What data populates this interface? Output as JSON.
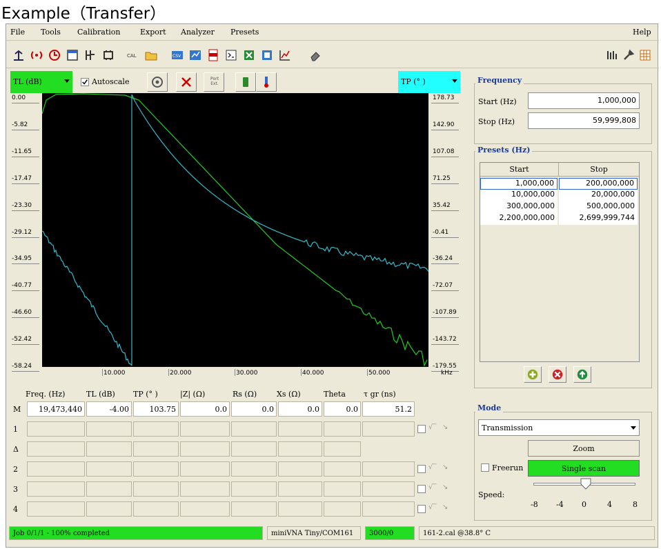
{
  "heading": "Example（Transfer）",
  "menu": {
    "file": "File",
    "tools": "Tools",
    "calibration": "Calibration",
    "export": "Export",
    "analyzer": "Analyzer",
    "presets": "Presets",
    "help": "Help"
  },
  "toolbar": {
    "icons": [
      "antenna-icon",
      "signal-icon",
      "clock-icon",
      "window-icon",
      "network-icon",
      "chip-icon",
      "cal-icon",
      "folder-icon",
      "csv-icon",
      "zplots-icon",
      "pdf-icon",
      "xml-icon",
      "excel-icon",
      "snp-icon",
      "chart-icon",
      "eraser-icon"
    ],
    "right_icons": [
      "generator-icon",
      "settings-icon",
      "calculator-icon"
    ]
  },
  "controls": {
    "left_scale": "TL (dB)",
    "autoscale_label": "Autoscale",
    "autoscale_checked": true,
    "port_ext_label": "Port Ext.",
    "right_scale": "TP (° )",
    "left_scale_color": "#22dd22",
    "right_scale_color": "#22ffff"
  },
  "plot": {
    "y_left_ticks": [
      "0.00",
      "-5.82",
      "-11.65",
      "-17.47",
      "-23.30",
      "-29.12",
      "-34.95",
      "-40.77",
      "-46.60",
      "-52.42",
      "-58.24"
    ],
    "y_right_ticks": [
      "178.73",
      "142.90",
      "107.08",
      "71.25",
      "35.42",
      "-0.41",
      "-36.24",
      "-72.07",
      "-107.89",
      "-143.72",
      "-179.55"
    ],
    "x_ticks": [
      "10.000",
      "20.000",
      "30.000",
      "40.000",
      "50.000"
    ],
    "x_unit": "kHz"
  },
  "table": {
    "headers": [
      "Freq. (Hz)",
      "TL (dB)",
      "TP (° )",
      "|Z| (Ω)",
      "Rs (Ω)",
      "Xs (Ω)",
      "Theta",
      "τ gr (ns)"
    ],
    "rows": [
      {
        "label": "M",
        "values": [
          "19,473,440",
          "-4.00",
          "103.75",
          "0.0",
          "0.0",
          "0.0",
          "0.0",
          "51.2"
        ]
      },
      {
        "label": "1",
        "values": [
          "",
          "",
          "",
          "",
          "",
          "",
          "",
          ""
        ]
      },
      {
        "label": "Δ",
        "values": [
          "",
          "",
          "",
          "",
          "",
          "",
          "",
          ""
        ]
      },
      {
        "label": "2",
        "values": [
          "",
          "",
          "",
          "",
          "",
          "",
          "",
          ""
        ]
      },
      {
        "label": "3",
        "values": [
          "",
          "",
          "",
          "",
          "",
          "",
          "",
          ""
        ]
      },
      {
        "label": "4",
        "values": [
          "",
          "",
          "",
          "",
          "",
          "",
          "",
          ""
        ]
      }
    ]
  },
  "frequency": {
    "title": "Frequency",
    "start_label": "Start (Hz)",
    "start_value": "1,000,000",
    "stop_label": "Stop (Hz)",
    "stop_value": "59,999,808"
  },
  "presets": {
    "title": "Presets (Hz)",
    "col_start": "Start",
    "col_stop": "Stop",
    "rows": [
      {
        "start": "1,000,000",
        "stop": "200,000,000"
      },
      {
        "start": "10,000,000",
        "stop": "20,000,000"
      },
      {
        "start": "300,000,000",
        "stop": "500,000,000"
      },
      {
        "start": "2,200,000,000",
        "stop": "2,699,999,744"
      }
    ]
  },
  "mode": {
    "title": "Mode",
    "selected": "Transmission",
    "zoom_label": "Zoom",
    "freerun_label": "Freerun",
    "single_scan_label": "Single scan",
    "speed_label": "Speed:",
    "speed_ticks": [
      "-8",
      "-4",
      "0",
      "4",
      "8"
    ],
    "speed_value": 0
  },
  "status": {
    "job": "Job 0/1/1 - 100% completed",
    "device": "miniVNA Tiny/COM161",
    "count": "3000/0",
    "cal": "161-2.cal @38.8° C"
  }
}
